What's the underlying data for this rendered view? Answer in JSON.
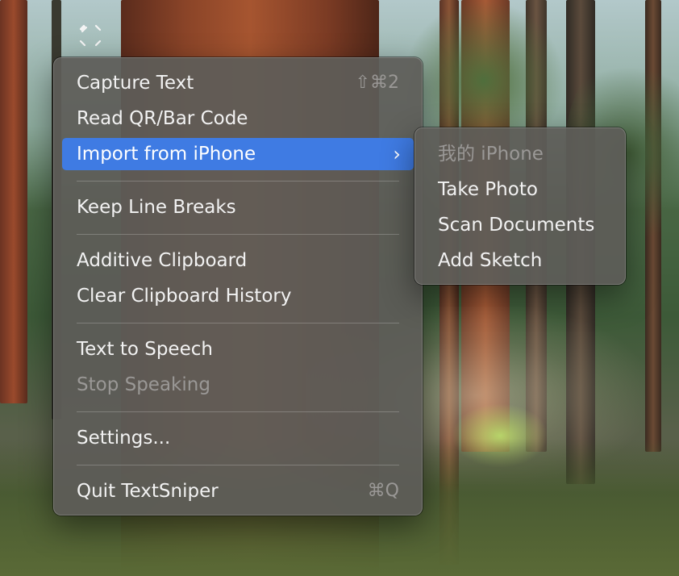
{
  "menubar": {
    "icon": "text-capture-icon"
  },
  "main_menu": {
    "capture_text": {
      "label": "Capture Text",
      "shortcut": "⇧⌘2"
    },
    "read_code": {
      "label": "Read QR/Bar Code"
    },
    "import_iphone": {
      "label": "Import from iPhone",
      "chevron": "›"
    },
    "keep_line_breaks": {
      "label": "Keep Line Breaks"
    },
    "additive_clipboard": {
      "label": "Additive Clipboard"
    },
    "clear_history": {
      "label": "Clear Clipboard History"
    },
    "text_to_speech": {
      "label": "Text to Speech"
    },
    "stop_speaking": {
      "label": "Stop Speaking"
    },
    "settings": {
      "label": "Settings..."
    },
    "quit": {
      "label": "Quit TextSniper",
      "shortcut": "⌘Q"
    }
  },
  "sub_menu": {
    "device": {
      "label": "我的 iPhone"
    },
    "take_photo": {
      "label": "Take Photo"
    },
    "scan_documents": {
      "label": "Scan Documents"
    },
    "add_sketch": {
      "label": "Add Sketch"
    }
  },
  "colors": {
    "menu_background": "#5e5c58",
    "highlight": "#3f7be3",
    "disabled_text": "#9a9896"
  }
}
